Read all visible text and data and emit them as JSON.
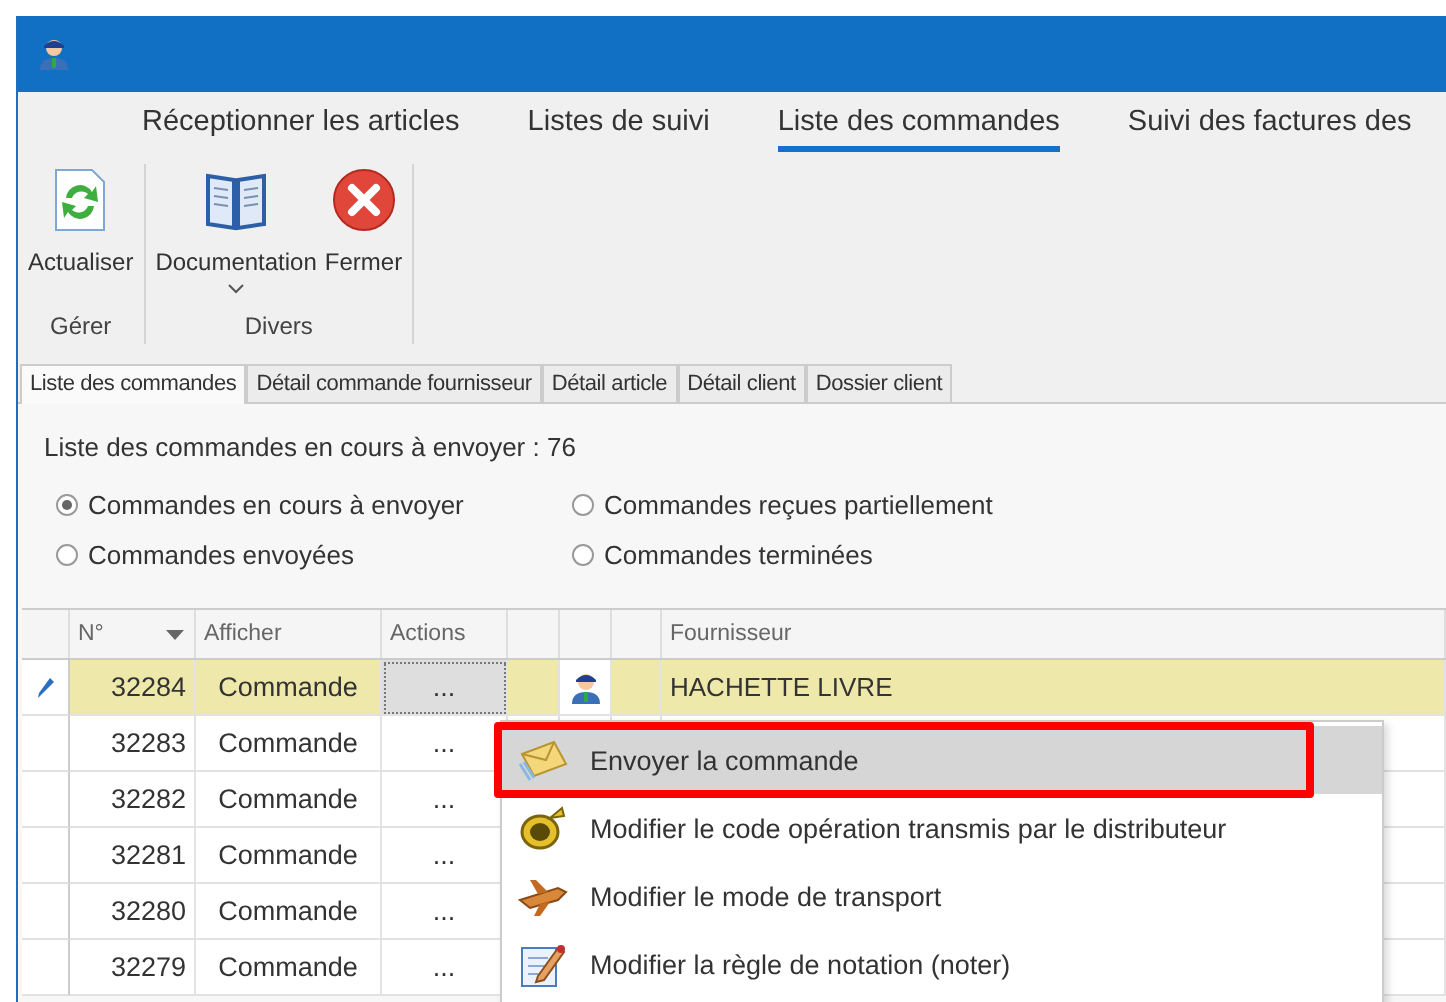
{
  "ribbon_tabs": [
    {
      "label": "Réceptionner les articles",
      "selected": false
    },
    {
      "label": "Listes de suivi",
      "selected": false
    },
    {
      "label": "Liste des commandes",
      "selected": true
    },
    {
      "label": "Suivi des factures des",
      "selected": false
    }
  ],
  "ribbon_groups": [
    {
      "label": "Gérer",
      "buttons": [
        {
          "label": "Actualiser",
          "kind": "refresh",
          "dropdown": false
        }
      ]
    },
    {
      "label": "Divers",
      "buttons": [
        {
          "label": "Documentation",
          "kind": "book",
          "dropdown": true
        },
        {
          "label": "Fermer",
          "kind": "close",
          "dropdown": false
        }
      ]
    }
  ],
  "doc_tabs": [
    {
      "label": "Liste des commandes",
      "selected": true
    },
    {
      "label": "Détail commande fournisseur",
      "selected": false
    },
    {
      "label": "Détail article",
      "selected": false
    },
    {
      "label": "Détail client",
      "selected": false
    },
    {
      "label": "Dossier client",
      "selected": false
    }
  ],
  "summary": "Liste des commandes en cours à envoyer : 76",
  "filters": [
    {
      "label": "Commandes en cours à envoyer",
      "selected": true
    },
    {
      "label": "Commandes reçues partiellement",
      "selected": false
    },
    {
      "label": "Commandes envoyées",
      "selected": false
    },
    {
      "label": "Commandes terminées",
      "selected": false
    }
  ],
  "table": {
    "columns": [
      {
        "kind": "text",
        "label": "N°",
        "sorted_descending": true
      },
      {
        "kind": "text",
        "label": "Afficher"
      },
      {
        "kind": "text",
        "label": "Actions"
      },
      {
        "kind": "blank"
      },
      {
        "kind": "blank"
      },
      {
        "kind": "blank"
      },
      {
        "kind": "text",
        "label": "Fournisseur"
      }
    ],
    "rows": [
      {
        "number": "32284",
        "afficher": "Commande",
        "actions": "...",
        "contact_icon": true,
        "supplier": "HACHETTE LIVRE",
        "selected": true,
        "editing": true
      },
      {
        "number": "32283",
        "afficher": "Commande",
        "actions": "...",
        "selected": false,
        "editing": false
      },
      {
        "number": "32282",
        "afficher": "Commande",
        "actions": "...",
        "selected": false,
        "editing": false
      },
      {
        "number": "32281",
        "afficher": "Commande",
        "actions": "...",
        "selected": false,
        "editing": false
      },
      {
        "number": "32280",
        "afficher": "Commande",
        "actions": "...",
        "selected": false,
        "editing": false
      },
      {
        "number": "32279",
        "afficher": "Commande",
        "actions": "...",
        "selected": false,
        "editing": false
      }
    ]
  },
  "context_menu": [
    {
      "label": "Envoyer la commande",
      "kind": "envelope",
      "selected": true,
      "callout": true
    },
    {
      "label": "Modifier le code opération transmis par le distributeur",
      "kind": "ring",
      "selected": false,
      "callout": false
    },
    {
      "label": "Modifier le mode de transport",
      "kind": "plane",
      "selected": false,
      "callout": false
    },
    {
      "label": "Modifier la règle de notation (noter)",
      "kind": "note",
      "selected": false,
      "callout": false
    }
  ]
}
